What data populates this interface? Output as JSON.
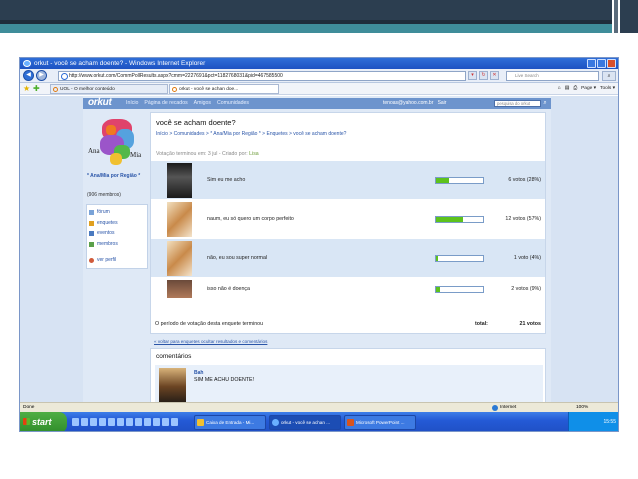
{
  "browser": {
    "title": "orkut - você se acham doente? - Windows Internet Explorer",
    "url": "http://www.orkut.com/CommPollResults.aspx?cmm=2227691&pct=1182768031&pid=467585500",
    "search_placeholder": "Live Search",
    "tabs": [
      {
        "label": "UOL - O melhor conteúdo"
      },
      {
        "label": "orkut - você se achan doe..."
      }
    ],
    "toolbar": {
      "page": "Page ▾",
      "tools": "Tools ▾"
    }
  },
  "orkut": {
    "logo": "orkut",
    "nav": [
      "Início",
      "Página de recados",
      "Amigos",
      "Comunidades"
    ],
    "email": "tenoas@yahoo.com.br",
    "logout": "Sair",
    "search_placeholder": "pesquisa do orkut"
  },
  "community": {
    "name": "* Ana/Mia por Região *",
    "members": "(906 membros)",
    "map_labels": [
      "Ana",
      "Mia"
    ],
    "menu": [
      {
        "label": "fórum",
        "icon": "forum-icon"
      },
      {
        "label": "enquetes",
        "icon": "poll-icon"
      },
      {
        "label": "eventos",
        "icon": "events-icon"
      },
      {
        "label": "membros",
        "icon": "members-icon"
      },
      {
        "label": "ver perfil",
        "icon": "profile-icon"
      }
    ]
  },
  "poll": {
    "title": "você se acham doente?",
    "breadcrumb": "Início > Comunidades > * Ana/Mia por Região * > Enquetes > você se acham doente?",
    "meta_prefix": "Votação terminou em: 3 jul - Criado por:",
    "creator": "Lisa",
    "answers": [
      {
        "text": "Sim eu me acho",
        "votes": "6 votos (28%)",
        "percent": 28
      },
      {
        "text": "naum, eu só quero um corpo perfeito",
        "votes": "12 votos (57%)",
        "percent": 57
      },
      {
        "text": "não, eu sou super normal",
        "votes": "1 voto (4%)",
        "percent": 4
      },
      {
        "text": "isso não é doença",
        "votes": "2 votos (9%)",
        "percent": 9
      }
    ],
    "closed_text": "O período de votação desta enquete terminou",
    "total_label": "total:",
    "total_value": "21 votos",
    "links": "« voltar para enquetes   ocultar resultados e comentários"
  },
  "comments": {
    "title": "comentários",
    "items": [
      {
        "author": "Bah",
        "text": "SIM ME ACHU DOENTE!"
      }
    ]
  },
  "status": {
    "left": "Done",
    "zone": "Internet",
    "zoom": "100%"
  },
  "taskbar": {
    "start": "start",
    "items": [
      {
        "label": "Caixa de Entrada - Mi..."
      },
      {
        "label": "orkut - você se achan ..."
      },
      {
        "label": "Microsoft PowerPoint ..."
      }
    ],
    "clock": "15:55"
  }
}
